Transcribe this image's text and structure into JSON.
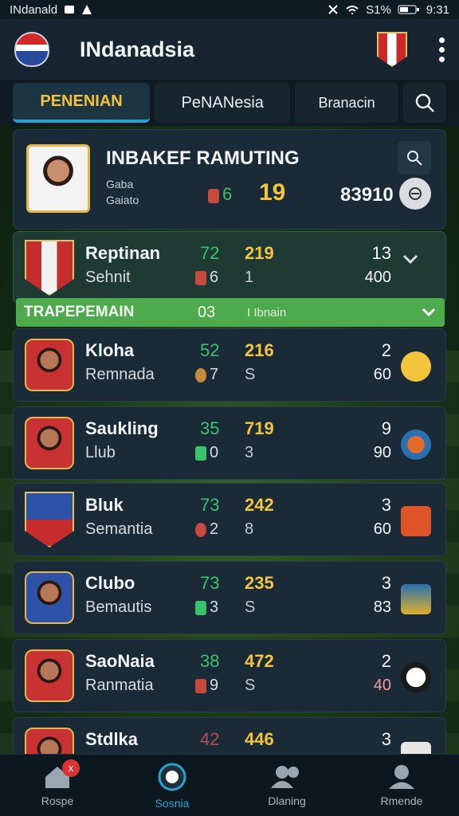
{
  "status_bar": {
    "carrier": "INdanald",
    "battery": "S1%",
    "time": "9:31"
  },
  "app_bar": {
    "title": "INdanadsia"
  },
  "tabs": [
    {
      "label": "PENENIAN"
    },
    {
      "label": "PeNANesia"
    },
    {
      "label": "Branacin"
    }
  ],
  "header": {
    "title": "INBAKEF RAMUTING",
    "line1": "Gaba",
    "line2": "Gaiato",
    "stat": "6",
    "number": "19",
    "code": "83910"
  },
  "highlight_row": {
    "name": "Reptinan",
    "sub": "Sehnit",
    "stat_top": "72",
    "stat_bottom": "6",
    "score": "219",
    "small": "1",
    "right_top": "13",
    "right_bottom": "400"
  },
  "section_bar": {
    "title": "TRAPEPEMAIN",
    "number": "03",
    "sub": "I Ibnain"
  },
  "rows": [
    {
      "name": "Kloha",
      "sub": "Remnada",
      "stat_top": "52",
      "stat_bottom": "7",
      "score": "216",
      "small": "S",
      "right_top": "2",
      "right_bottom": "60"
    },
    {
      "name": "Saukling",
      "sub": "Llub",
      "stat_top": "35",
      "stat_bottom": "0",
      "score": "719",
      "small": "3",
      "right_top": "9",
      "right_bottom": "90"
    },
    {
      "name": "Bluk",
      "sub": "Semantia",
      "stat_top": "73",
      "stat_bottom": "2",
      "score": "242",
      "small": "8",
      "right_top": "3",
      "right_bottom": "60"
    },
    {
      "name": "Clubo",
      "sub": "Bemautis",
      "stat_top": "73",
      "stat_bottom": "3",
      "score": "235",
      "small": "S",
      "right_top": "3",
      "right_bottom": "83"
    },
    {
      "name": "SaoNaia",
      "sub": "Ranmatia",
      "stat_top": "38",
      "stat_bottom": "9",
      "score": "472",
      "small": "S",
      "right_top": "2",
      "right_bottom": "40"
    },
    {
      "name": "Stdlka",
      "sub": "",
      "stat_top": "42",
      "stat_bottom": "",
      "score": "446",
      "small": "",
      "right_top": "3",
      "right_bottom": ""
    }
  ],
  "bottom_nav": [
    {
      "label": "Rospe",
      "badge": "x"
    },
    {
      "label": "Sosnia"
    },
    {
      "label": "Dlaning"
    },
    {
      "label": "Rmende"
    }
  ]
}
